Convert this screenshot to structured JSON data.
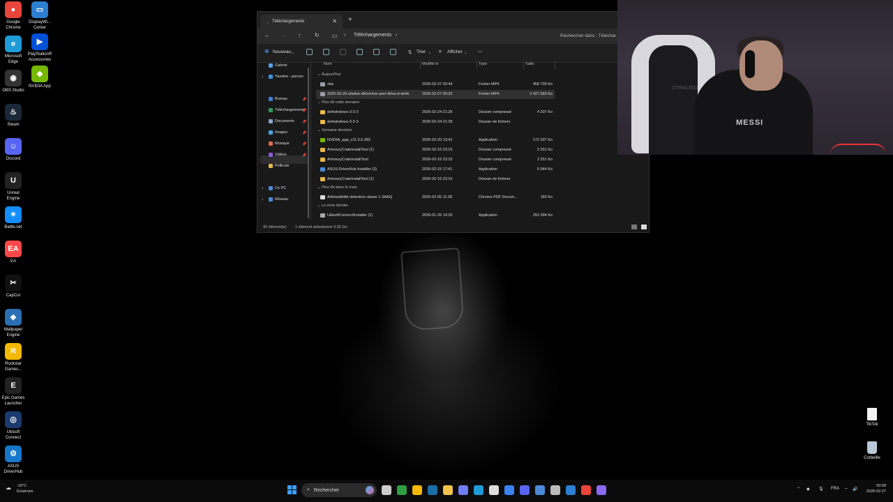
{
  "desktop": {
    "left_col": [
      {
        "label": "Google Chrome",
        "icon": "chrome-icon",
        "color": "#e8453c",
        "glyph": "●"
      },
      {
        "label": "Microsoft Edge",
        "icon": "edge-icon",
        "color": "#1f9bd8",
        "glyph": "e"
      },
      {
        "label": "OBS Studio",
        "icon": "obs-icon",
        "color": "#333333",
        "glyph": "◉"
      },
      {
        "label": "Steam",
        "icon": "steam-icon",
        "color": "#1b2838",
        "glyph": "♨"
      },
      {
        "label": "Discord",
        "icon": "discord-icon",
        "color": "#5865f2",
        "glyph": "☺"
      },
      {
        "label": "Unreal Engine",
        "icon": "unreal-icon",
        "color": "#222222",
        "glyph": "U"
      },
      {
        "label": "Battle.net",
        "icon": "battlenet-icon",
        "color": "#148eff",
        "glyph": "✶"
      },
      {
        "label": "EA",
        "icon": "ea-icon",
        "color": "#ff4747",
        "glyph": "EA"
      },
      {
        "label": "CapCut",
        "icon": "capcut-icon",
        "color": "#111111",
        "glyph": "✂"
      },
      {
        "label": "Wallpaper Engine",
        "icon": "wallpaper-engine-icon",
        "color": "#2a6fb3",
        "glyph": "◈"
      },
      {
        "label": "Rockstar Games...",
        "icon": "rockstar-icon",
        "color": "#f5b800",
        "glyph": "R"
      },
      {
        "label": "Epic Games Launcher",
        "icon": "epic-games-icon",
        "color": "#222222",
        "glyph": "E"
      },
      {
        "label": "Ubisoft Connect",
        "icon": "ubisoft-icon",
        "color": "#1b3b6f",
        "glyph": "◎"
      },
      {
        "label": "ASUS DriverHub",
        "icon": "asus-driverhub-icon",
        "color": "#1778c9",
        "glyph": "⚙"
      }
    ],
    "second_col": [
      {
        "label": "DisplayWi... Center",
        "icon": "display-widget-icon",
        "color": "#2d7fd2",
        "glyph": "▭"
      },
      {
        "label": "PlayStation® Accessories",
        "icon": "playstation-icon",
        "color": "#0050d8",
        "glyph": "▶"
      },
      {
        "label": "NVIDIA App",
        "icon": "nvidia-icon",
        "color": "#76b900",
        "glyph": "◆"
      }
    ],
    "right_icons": [
      {
        "label": "TikTok",
        "icon": "file-icon"
      },
      {
        "label": "Corbeille",
        "icon": "recycle-bin-icon"
      }
    ]
  },
  "explorer": {
    "tab_title": "Téléchargements",
    "breadcrumb": "Téléchargements",
    "search_placeholder": "Rechercher dans : Téléchar",
    "toolbar": {
      "new": "Nouveau",
      "sort": "Trier",
      "view": "Afficher",
      "more": "···"
    },
    "sidebar": {
      "top": [
        {
          "label": "Galerie",
          "icon": "gallery-icon",
          "color": "#5aa0e6"
        },
        {
          "label": "Yassine - person",
          "icon": "onedrive-icon",
          "color": "#3b8fe0"
        }
      ],
      "pinned": [
        {
          "label": "Bureau",
          "icon": "desktop-folder-icon",
          "color": "#3d7fd6"
        },
        {
          "label": "Téléchargements",
          "icon": "downloads-folder-icon",
          "color": "#2e9b5c"
        },
        {
          "label": "Documents",
          "icon": "documents-folder-icon",
          "color": "#8aa4c8"
        },
        {
          "label": "Images",
          "icon": "pictures-folder-icon",
          "color": "#4aa3e0"
        },
        {
          "label": "Musique",
          "icon": "music-folder-icon",
          "color": "#e06a4a"
        },
        {
          "label": "Vidéos",
          "icon": "videos-folder-icon",
          "color": "#8a5ad8"
        },
        {
          "label": "Pellicule",
          "icon": "folder-icon",
          "color": "#e8b84a"
        }
      ],
      "bottom": [
        {
          "label": "Ce PC",
          "icon": "pc-icon",
          "color": "#4a8ad8"
        },
        {
          "label": "Réseau",
          "icon": "network-icon",
          "color": "#4a8ad8"
        }
      ]
    },
    "columns": {
      "name": "Nom",
      "modified": "Modifié le",
      "type": "Type",
      "size": "Taille"
    },
    "groups": [
      {
        "label": "Aujourd'hui",
        "rows": [
          {
            "name": "zba",
            "modified": "2026-02-27 00:44",
            "type": "Fichier MP4",
            "size": "458 709 Ko",
            "icon": "video-file-icon",
            "color": "#9a9aa8",
            "selected": false
          },
          {
            "name": "2026-02-26-zbelive-dkhol-live-azer-tkhra-b-dehk",
            "modified": "2026-02-27 00:33",
            "type": "Fichier MP4",
            "size": "3 427 583 Ko",
            "icon": "video-file-icon",
            "color": "#9a9aa8",
            "selected": true
          }
        ]
      },
      {
        "label": "Plus tôt cette semaine",
        "rows": [
          {
            "name": "ds4windows-3-3-3",
            "modified": "2026-02-24 21:28",
            "type": "Dossier compressé",
            "size": "4 207 Ko",
            "icon": "zip-folder-icon",
            "color": "#e8b84a",
            "selected": false
          },
          {
            "name": "ds4windows-3-3-3",
            "modified": "2026-02-24 21:28",
            "type": "Dossier de fichiers",
            "size": "",
            "icon": "folder-icon",
            "color": "#e8b84a",
            "selected": false
          }
        ]
      },
      {
        "label": "Semaine dernière",
        "rows": [
          {
            "name": "NVIDIA_app_v11.0.6.383",
            "modified": "2026-02-20 13:41",
            "type": "Application",
            "size": "172 037 Ko",
            "icon": "nvidia-icon",
            "color": "#76b900",
            "selected": false
          },
          {
            "name": "ArmouryCrateInstallTool (1)",
            "modified": "2026-02-16 23:15",
            "type": "Dossier compressé",
            "size": "2 251 Ko",
            "icon": "zip-folder-icon",
            "color": "#e8b84a",
            "selected": false
          },
          {
            "name": "ArmouryCrateInstallTool",
            "modified": "2026-02-16 23:15",
            "type": "Dossier compressé",
            "size": "2 251 Ko",
            "icon": "zip-folder-icon",
            "color": "#e8b84a",
            "selected": false
          },
          {
            "name": "ASUS-DriverHub-Installer (3)",
            "modified": "2026-02-15 17:41",
            "type": "Application",
            "size": "5 044 Ko",
            "icon": "asus-icon",
            "color": "#4a8ad8",
            "selected": false
          },
          {
            "name": "ArmouryCrateInstallTool (1)",
            "modified": "2026-02-16 23:16",
            "type": "Dossier de fichiers",
            "size": "",
            "icon": "folder-icon",
            "color": "#e8b84a",
            "selected": false
          }
        ]
      },
      {
        "label": "Plus tôt dans le mois",
        "rows": [
          {
            "name": "Admissibilité obtention classe 1 SAAQ",
            "modified": "2026-02-05 11:28",
            "type": "Chrome PDF Docum...",
            "size": "183 Ko",
            "icon": "pdf-icon",
            "color": "#dddddd",
            "selected": false
          }
        ]
      },
      {
        "label": "Le mois dernier",
        "rows": [
          {
            "name": "UbisoftConnectInstaller (1)",
            "modified": "2026-01-26 14:20",
            "type": "Application",
            "size": "252 994 Ko",
            "icon": "ubisoft-icon",
            "color": "#aaaaaa",
            "selected": false
          }
        ]
      }
    ],
    "status": {
      "count": "42 élément(s)",
      "selection": "1 élément sélectionné  3,26 Go"
    }
  },
  "webcam": {
    "shirt_text": "MESSI",
    "chair_text": "GTRACING"
  },
  "taskbar": {
    "weather_temp": "-16°C",
    "weather_desc": "Éclaircies",
    "search_label": "Rechercher",
    "lang": "FRA",
    "time": "00:58",
    "date": "2026-02-27",
    "apps": [
      {
        "name": "task-view-icon",
        "color": "#cccccc"
      },
      {
        "name": "xbox-icon",
        "color": "#2ea043"
      },
      {
        "name": "rockstar-icon",
        "color": "#f5b800"
      },
      {
        "name": "steam-icon",
        "color": "#1b6fa8"
      },
      {
        "name": "file-explorer-icon",
        "color": "#f2c14e"
      },
      {
        "name": "copilot-icon",
        "color": "#6f7df5"
      },
      {
        "name": "edge-icon",
        "color": "#1f9bd8"
      },
      {
        "name": "notepad-icon",
        "color": "#dddddd"
      },
      {
        "name": "mail-icon",
        "color": "#3b82f6"
      },
      {
        "name": "discord-icon",
        "color": "#5865f2"
      },
      {
        "name": "ea-icon",
        "color": "#4a8ad8"
      },
      {
        "name": "settings-icon",
        "color": "#bbbbbb"
      },
      {
        "name": "display-widget-icon",
        "color": "#2d7fd2"
      },
      {
        "name": "chrome-icon",
        "color": "#e8453c"
      },
      {
        "name": "game-controller-icon",
        "color": "#8a6af0"
      }
    ]
  }
}
